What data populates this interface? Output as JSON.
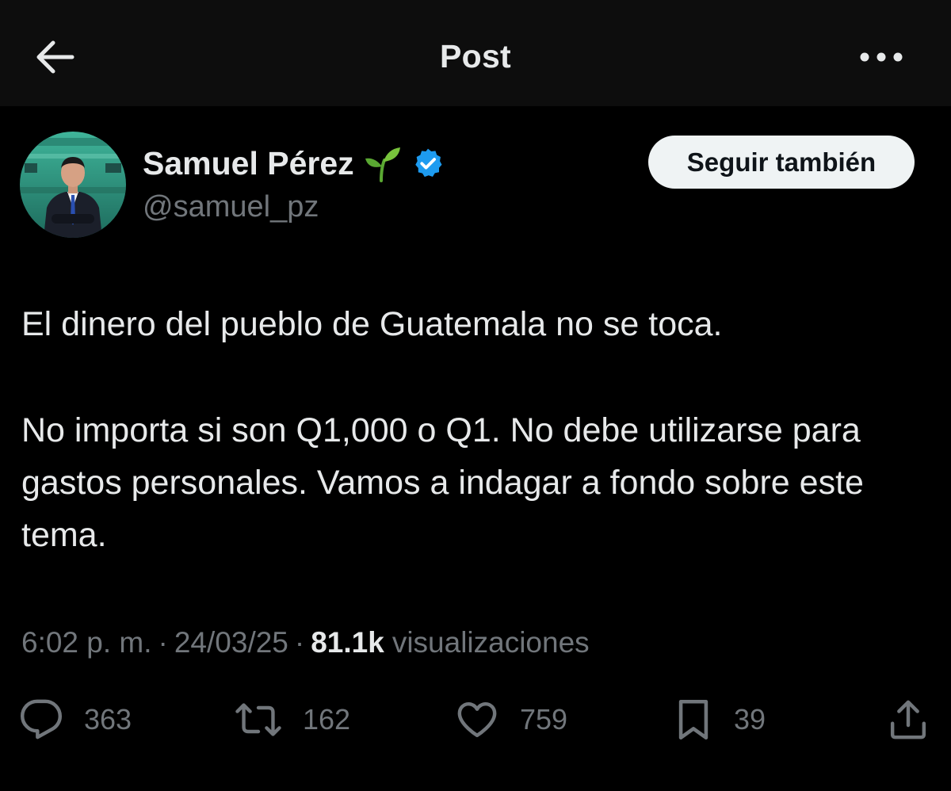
{
  "header": {
    "title": "Post",
    "back_icon": "arrow-left-icon",
    "more_icon": "more-horizontal-icon"
  },
  "author": {
    "name": "Samuel Pérez",
    "emoji_icon": "seedling-icon",
    "verified_icon": "verified-badge-icon",
    "handle": "@samuel_pz",
    "follow_label": "Seguir también"
  },
  "post": {
    "paragraphs": [
      "El dinero del pueblo de Guatemala no se toca.",
      "No importa si son Q1,000 o Q1. No debe utilizarse para gastos personales. Vamos a indagar a fondo sobre este tema."
    ]
  },
  "meta": {
    "time": "6:02 p. m.",
    "date": "24/03/25",
    "separator": "·",
    "views_count": "81.1k",
    "views_label": "visualizaciones"
  },
  "actions": {
    "replies": "363",
    "reposts": "162",
    "likes": "759",
    "bookmarks": "39"
  },
  "colors": {
    "background": "#000000",
    "header_background": "#0d0d0d",
    "primary_text": "#e7e9ea",
    "secondary_text": "#71767b",
    "verified_blue": "#1d9bf0",
    "button_background": "#eff3f4",
    "button_text": "#0f1419"
  }
}
